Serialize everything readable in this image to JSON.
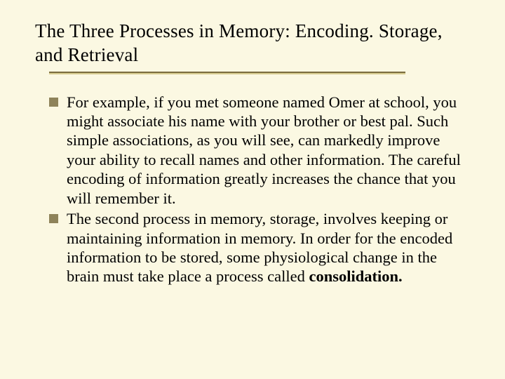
{
  "slide": {
    "title": "The Three Processes in Memory: Encoding. Storage, and Retrieval",
    "bullets": [
      {
        "text": "For example, if you met someone named Omer at school, you might associate his name with your brother or best pal. Such simple associations, as you will see, can markedly improve your ability to recall names and other information. The careful encoding of information greatly increases the chance that you will remember it."
      },
      {
        "text_prefix": "The second process in memory, storage, involves keeping or maintaining information in memory. In order for the encoded information to be stored, some physiological change in the brain must take place a process called ",
        "text_bold": "consolidation."
      }
    ]
  }
}
